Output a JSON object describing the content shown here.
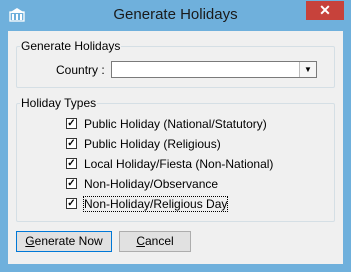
{
  "window": {
    "title": "Generate Holidays",
    "close_glyph": "✕",
    "app_icon": "building-icon"
  },
  "group_holidays": {
    "legend": "Generate Holidays",
    "country_label": "Country :",
    "country_value": ""
  },
  "group_types": {
    "legend": "Holiday Types",
    "items": [
      {
        "label": "Public Holiday (National/Statutory)",
        "checked": true
      },
      {
        "label": "Public Holiday (Religious)",
        "checked": true
      },
      {
        "label": "Local Holiday/Fiesta (Non-National)",
        "checked": true
      },
      {
        "label": "Non-Holiday/Observance",
        "checked": true
      },
      {
        "label": "Non-Holiday/Religious Day",
        "checked": true
      }
    ]
  },
  "buttons": {
    "generate_first": "G",
    "generate_rest": "enerate Now",
    "cancel_first": "C",
    "cancel_rest": "ancel"
  },
  "colors": {
    "frame": "#6fb0dc",
    "close": "#c7423b",
    "client": "#f0f0f0"
  }
}
